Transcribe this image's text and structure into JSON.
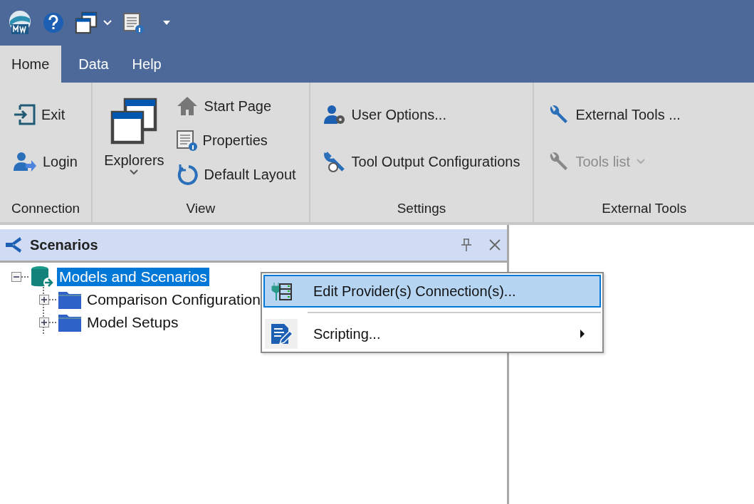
{
  "tabs": [
    {
      "label": "Home",
      "selected": true
    },
    {
      "label": "Data",
      "selected": false
    },
    {
      "label": "Help",
      "selected": false
    }
  ],
  "ribbon_groups": [
    {
      "label": "Connection",
      "items": [
        {
          "label": "Exit",
          "kind": "small",
          "disabled": false,
          "dropdown": false
        },
        {
          "label": "Login",
          "kind": "small",
          "disabled": false,
          "dropdown": false
        }
      ]
    },
    {
      "label": "View",
      "items": [
        {
          "label": "Explorers",
          "kind": "large",
          "disabled": false,
          "dropdown": true
        },
        {
          "label": "Start Page",
          "kind": "small",
          "disabled": false,
          "dropdown": false
        },
        {
          "label": "Properties",
          "kind": "small",
          "disabled": false,
          "dropdown": false
        },
        {
          "label": "Default Layout",
          "kind": "small",
          "disabled": false,
          "dropdown": false
        }
      ]
    },
    {
      "label": "Settings",
      "items": [
        {
          "label": "User Options...",
          "kind": "small",
          "disabled": false,
          "dropdown": false
        },
        {
          "label": "Tool Output Configurations",
          "kind": "small",
          "disabled": false,
          "dropdown": false
        }
      ]
    },
    {
      "label": "External Tools",
      "items": [
        {
          "label": "External Tools ...",
          "kind": "small",
          "disabled": false,
          "dropdown": false
        },
        {
          "label": "Tools list",
          "kind": "small",
          "disabled": true,
          "dropdown": true
        }
      ]
    }
  ],
  "panel": {
    "title": "Scenarios",
    "tree": [
      {
        "label": "Models and Scenarios",
        "selected": true,
        "expanded": true,
        "children": [
          {
            "label": "Comparison Configuration",
            "selected": false,
            "expanded": false
          },
          {
            "label": "Model Setups",
            "selected": false,
            "expanded": false
          }
        ]
      }
    ]
  },
  "context_menu": [
    {
      "label": "Edit Provider(s) Connection(s)...",
      "selected": true,
      "submenu": false
    },
    {
      "label": "Scripting...",
      "selected": false,
      "submenu": true
    }
  ]
}
